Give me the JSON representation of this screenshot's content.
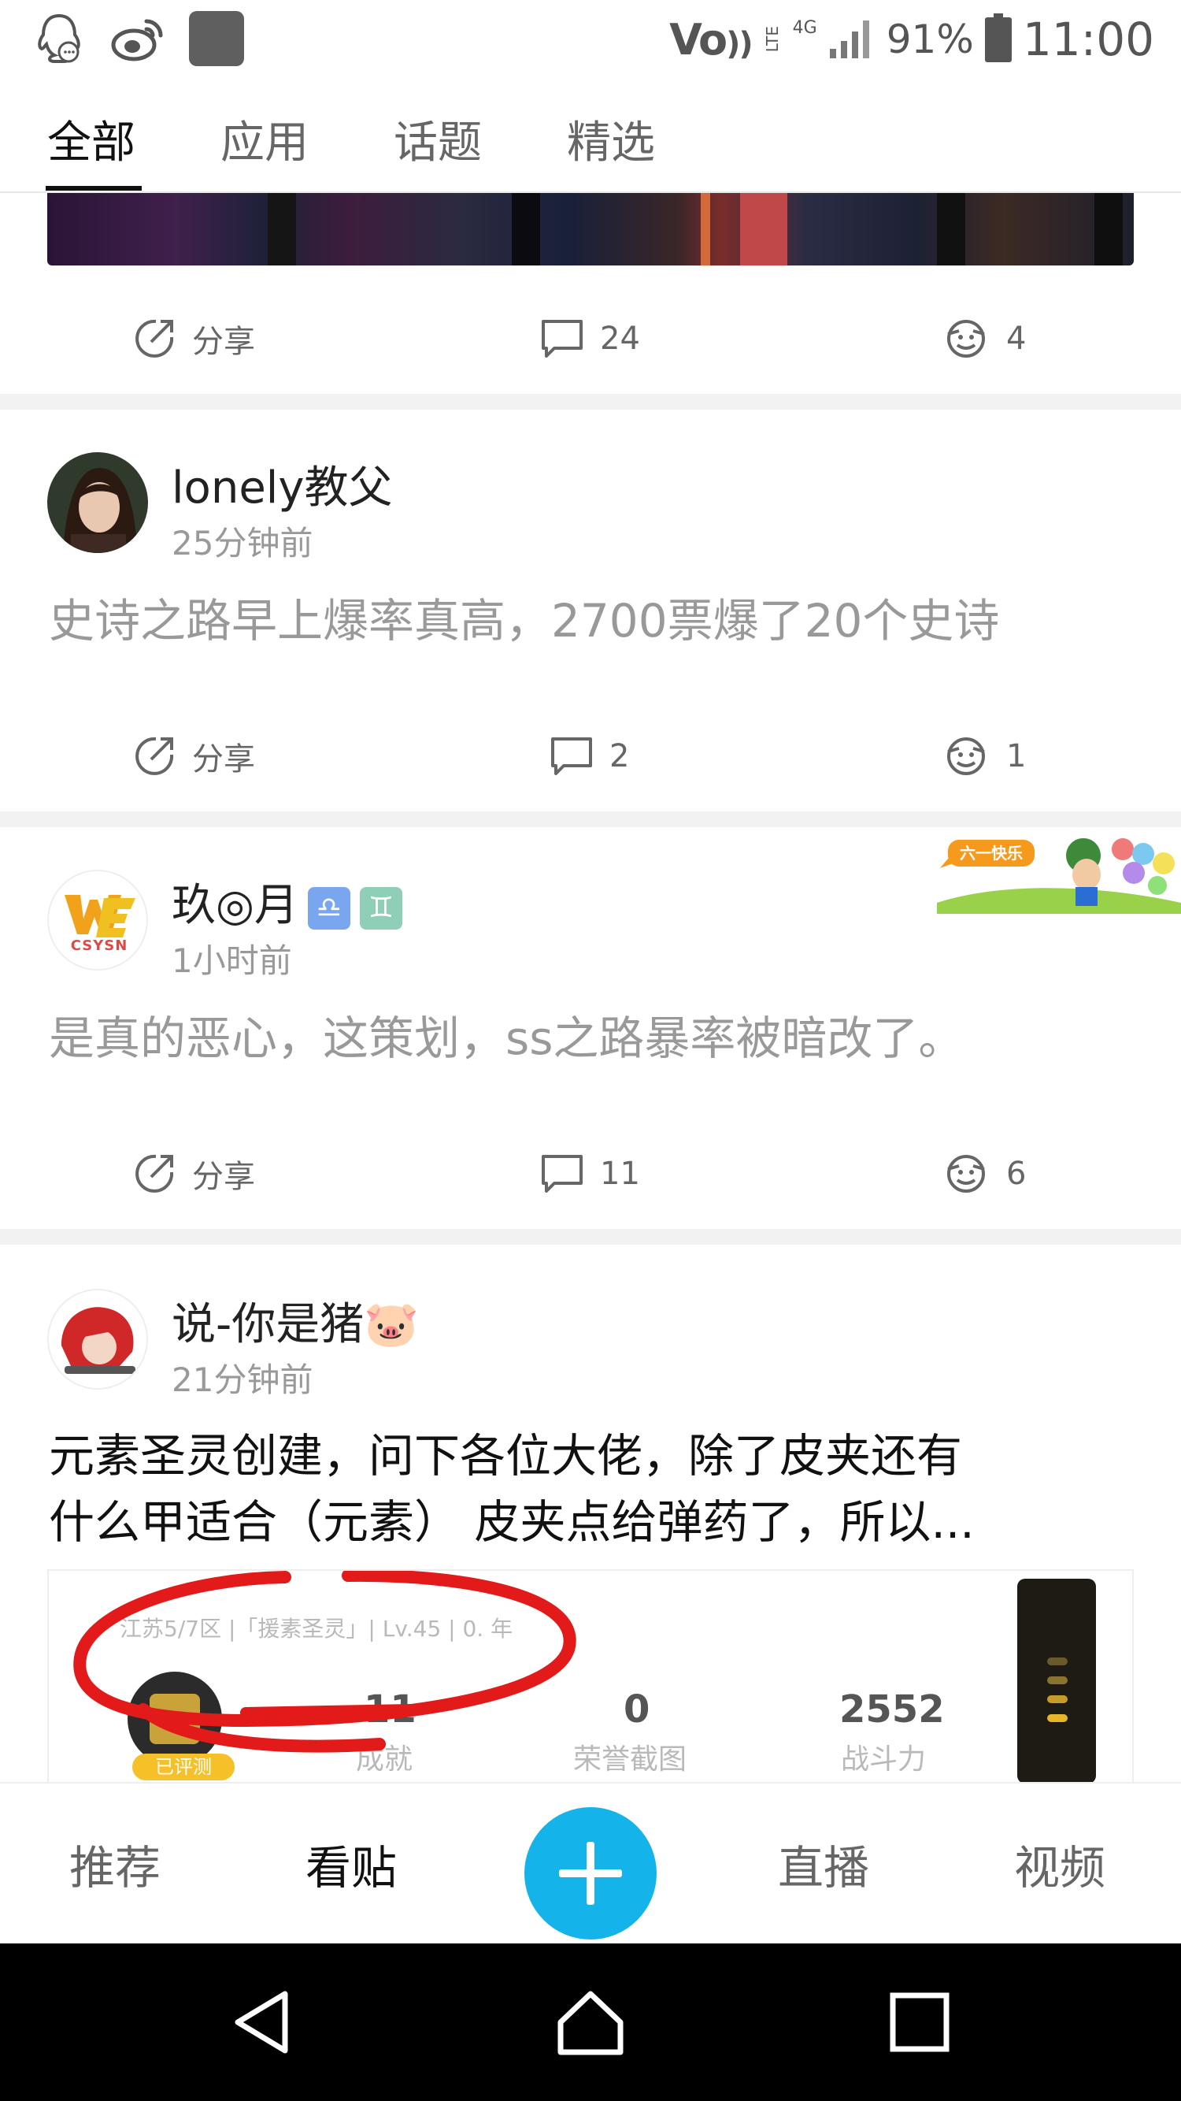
{
  "status_bar": {
    "network_label": "Vo",
    "lte_label": "LTE",
    "signal_label": "4G",
    "battery_percent": "91%",
    "time": "11:00",
    "icons": [
      "qq-icon",
      "weibo-icon",
      "gallery-icon",
      "hd-call-icon",
      "signal-icon",
      "battery-icon"
    ]
  },
  "tabs": [
    {
      "label": "全部",
      "active": true
    },
    {
      "label": "应用",
      "active": false
    },
    {
      "label": "话题",
      "active": false
    },
    {
      "label": "精选",
      "active": false
    }
  ],
  "posts": [
    {
      "share_label": "分享",
      "comments": "24",
      "likes": "4"
    },
    {
      "username": "lonely教父",
      "time_ago": "25分钟前",
      "text": "史诗之路早上爆率真高，2700票爆了20个史诗",
      "share_label": "分享",
      "comments": "2",
      "likes": "1"
    },
    {
      "username": "玖◎月",
      "badges": [
        "♎",
        "♊"
      ],
      "avatar_text": "CSYSN",
      "time_ago": "1小时前",
      "text": "是真的恶心，这策划，ss之路暴率被暗改了。",
      "decoration_text": "六一快乐",
      "share_label": "分享",
      "comments": "11",
      "likes": "6"
    },
    {
      "username": "说-你是猪🐷",
      "time_ago": "21分钟前",
      "text_line1": "元素圣灵创建，问下各位大佬，除了皮夹还有",
      "text_line2": "什么甲适合（元素） 皮夹点给弹药了，所以...",
      "image": {
        "header": "江苏5/7区 |「援素圣灵」| Lv.45 | 0. 年",
        "badge": "已评测",
        "stats": [
          {
            "value": "11",
            "label": "成就"
          },
          {
            "value": "0",
            "label": "荣誉截图"
          },
          {
            "value": "2552",
            "label": "战斗力"
          }
        ]
      }
    }
  ],
  "bottom_nav": {
    "items": [
      {
        "label": "推荐",
        "active": false
      },
      {
        "label": "看贴",
        "active": true
      },
      {
        "label": "直播",
        "active": false
      },
      {
        "label": "视频",
        "active": false
      }
    ],
    "fab_icon": "plus-icon",
    "fab_color": "#14b3ea"
  },
  "system_nav": [
    "back-icon",
    "home-icon",
    "recents-icon"
  ]
}
